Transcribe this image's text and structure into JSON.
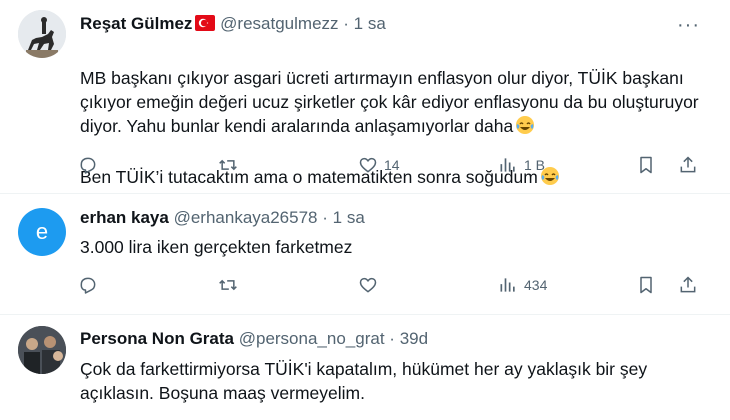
{
  "tweets": [
    {
      "name": "Reşat Gülmez",
      "handle": "@resatgulmezz",
      "time": "1 sa",
      "text": "MB başkanı çıkıyor asgari ücreti artırmayın enflasyon olur diyor, TÜİK başkanı çıkıyor emeğin değeri ucuz şirketler çok kâr ediyor enflasyonu da bu oluşturuyor diyor. Yahu bunlar kendi aralarında anlaşamıyorlar daha",
      "text2": "Ben TÜİK’i tutacaktım ama o matematikten sonra soğudum",
      "likes": "14",
      "views": "1 B"
    },
    {
      "name": "erhan kaya",
      "handle": "@erhankaya26578",
      "time": "1 sa",
      "avatar_letter": "e",
      "text": "3.000 lira iken gerçekten farketmez",
      "likes": "",
      "views": "434"
    },
    {
      "name": "Persona Non Grata",
      "handle": "@persona_no_grat",
      "time": "39d",
      "text": "Çok da farkettirmiyorsa TÜİK'i kapatalım, hükümet her ay yaklaşık bir şey açıklasın. Boşuna maaş vermeyelim."
    }
  ],
  "dot": "·",
  "more": "···",
  "colors": {
    "icon": "#536471",
    "avatar_e": "#1d9bf0",
    "flag_red": "#e30a17"
  }
}
